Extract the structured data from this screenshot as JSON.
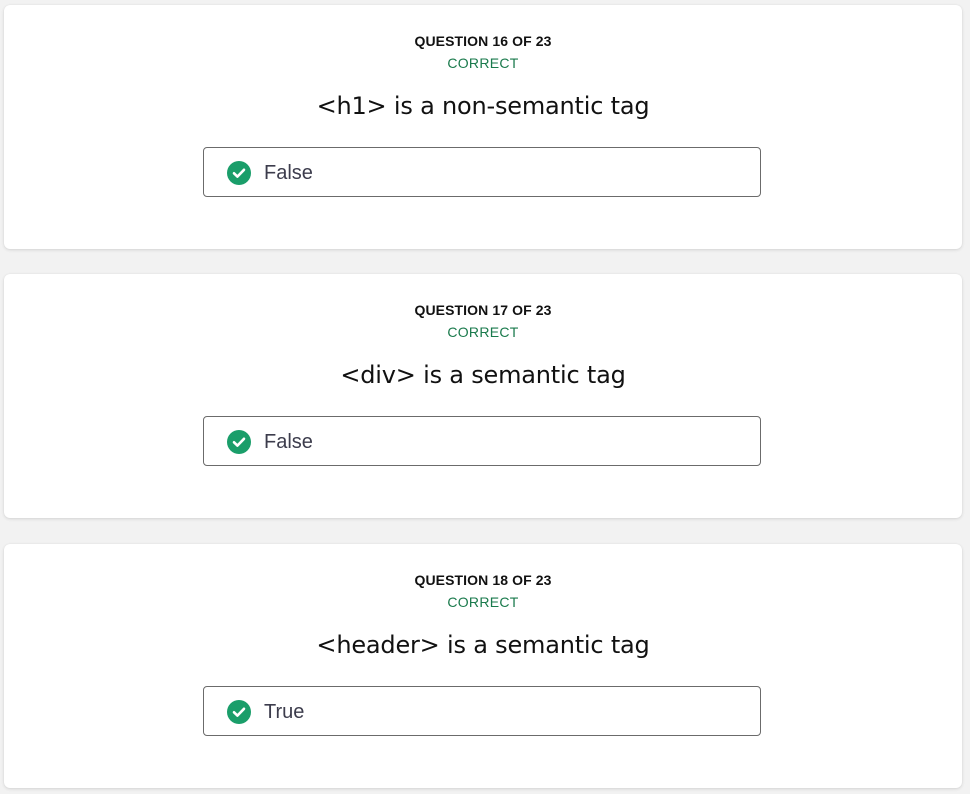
{
  "questions": [
    {
      "counter": "QUESTION 16 OF 23",
      "status": "CORRECT",
      "text": "<h1> is a non-semantic tag",
      "answer": "False",
      "answer_icon": "check-circle-icon"
    },
    {
      "counter": "QUESTION 17 OF 23",
      "status": "CORRECT",
      "text": "<div> is a semantic tag",
      "answer": "False",
      "answer_icon": "check-circle-icon"
    },
    {
      "counter": "QUESTION 18 OF 23",
      "status": "CORRECT",
      "text": "<header> is a semantic tag",
      "answer": "True",
      "answer_icon": "check-circle-icon"
    }
  ],
  "colors": {
    "correct_green": "#1a7a4c",
    "check_fill": "#1a9e6a",
    "page_background": "#f2f2f2",
    "card_background": "#ffffff"
  }
}
